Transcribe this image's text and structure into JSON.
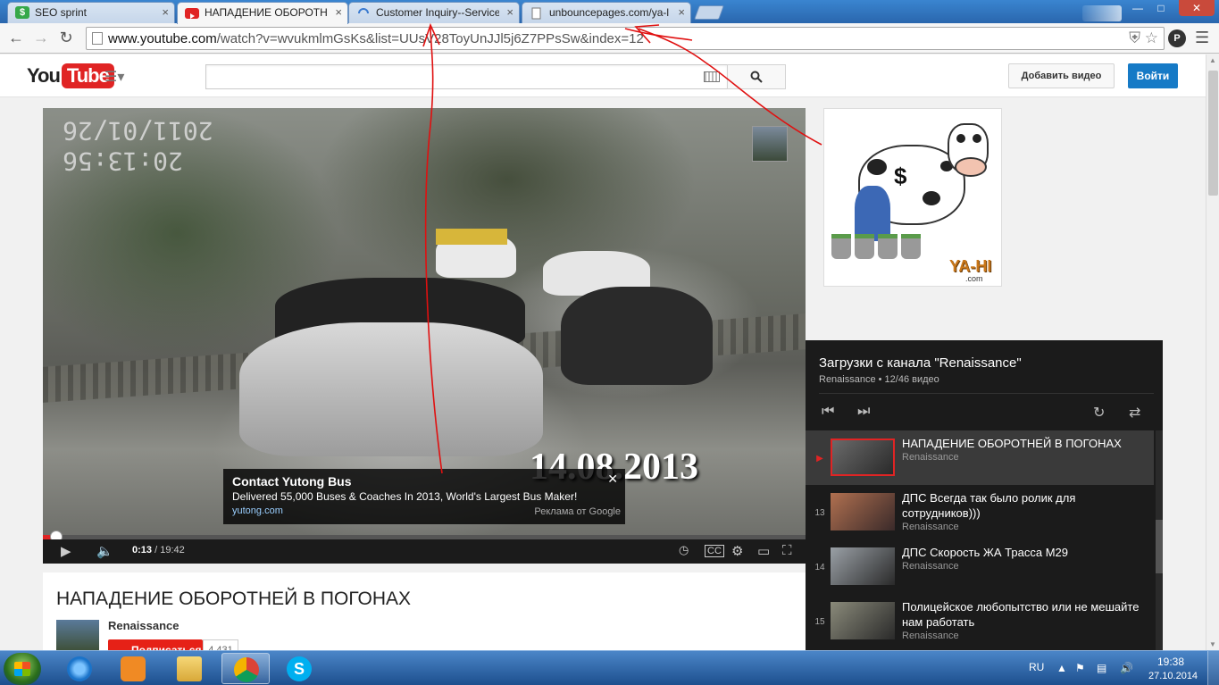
{
  "browser": {
    "tabs": [
      {
        "title": "SEO sprint",
        "icon": "seosprint-favicon",
        "color": "#35a84a"
      },
      {
        "title": "НАПАДЕНИЕ ОБОРОТНЕ",
        "icon": "youtube-favicon",
        "color": "#e02424"
      },
      {
        "title": "Customer Inquiry--Service",
        "icon": "loading-spinner-icon",
        "color": "#3a7ad0"
      },
      {
        "title": "unbouncepages.com/ya-l",
        "icon": "page-icon",
        "color": "#777777"
      }
    ],
    "close_glyph": "×",
    "url_host": "www.youtube.com",
    "url_path": "/watch?v=wvukmlmGsKs&list=UUsV28ToyUnJJl5j6Z7PPsSw&index=12",
    "extension_label": "P"
  },
  "youtube": {
    "logo_you": "You",
    "logo_tube": "Tube",
    "upload_label": "Добавить видео",
    "signin_label": "Войти",
    "search_placeholder": ""
  },
  "player": {
    "timestamp_line1": "20:13:56",
    "timestamp_line2": "2011/01/26",
    "date_overlay": "14.08.2013",
    "current_time": "0:13",
    "duration": "/ 19:42",
    "progress": 0.011,
    "ad": {
      "title": "Contact Yutong Bus",
      "description": "Delivered 55,000 Buses & Coaches In 2013, World's Largest Bus Maker!",
      "url": "yutong.com",
      "label": "Реклама от Google"
    }
  },
  "side_ad": {
    "brand": "YA-HI",
    "domain": ".com",
    "dollar": "$"
  },
  "playlist": {
    "title": "Загрузки с канала \"Renaissance\"",
    "subtitle": "Renaissance • 12/46 видео",
    "items": [
      {
        "index": "▶",
        "title": "НАПАДЕНИЕ ОБОРОТНЕЙ В ПОГОНАХ",
        "owner": "Renaissance",
        "current": true
      },
      {
        "index": "13",
        "title": "ДПС Всегда так было ролик для сотрудников)))",
        "owner": "Renaissance",
        "current": false
      },
      {
        "index": "14",
        "title": "ДПС Скорость ЖА Трасса М29",
        "owner": "Renaissance",
        "current": false
      },
      {
        "index": "15",
        "title": "Полицейское любопытство или не мешайте нам работать",
        "owner": "Renaissance",
        "current": false
      }
    ]
  },
  "watch": {
    "title": "НАПАДЕНИЕ ОБОРОТНЕЙ В ПОГОНАХ",
    "owner": "Renaissance",
    "subscribe_label": "Подписаться",
    "subscriber_count": "4 431"
  },
  "taskbar": {
    "language": "RU",
    "time": "19:38",
    "date": "27.10.2014"
  },
  "colors": {
    "youtube_red": "#e02424",
    "signin_blue": "#167ac6",
    "annotation_red": "#e01010"
  }
}
